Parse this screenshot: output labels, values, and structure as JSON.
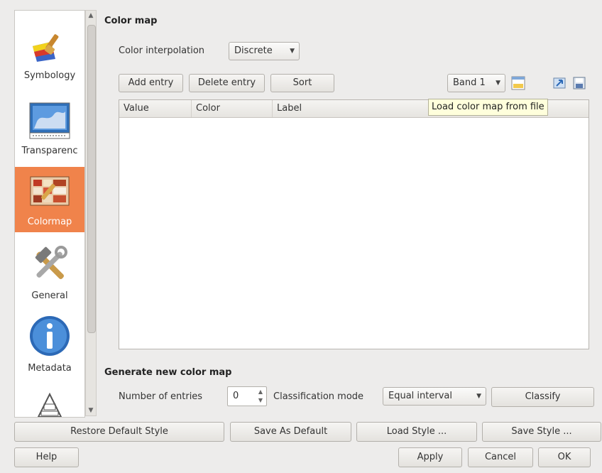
{
  "sidebar": {
    "items": [
      {
        "label": "Symbology",
        "icon": "paintbrush-icon"
      },
      {
        "label": "Transparenc",
        "icon": "transparency-icon"
      },
      {
        "label": "Colormap",
        "icon": "colormap-icon",
        "active": true
      },
      {
        "label": "General",
        "icon": "hammer-wrench-icon"
      },
      {
        "label": "Metadata",
        "icon": "info-icon"
      },
      {
        "label": "",
        "icon": "pyramids-icon"
      }
    ]
  },
  "colormap": {
    "title": "Color map",
    "interpolation_label": "Color interpolation",
    "interpolation_value": "Discrete",
    "add_entry": "Add entry",
    "delete_entry": "Delete entry",
    "sort": "Sort",
    "band_value": "Band 1",
    "table": {
      "columns": [
        "Value",
        "Color",
        "Label"
      ],
      "rows": []
    },
    "tooltip": "Load color map from file"
  },
  "generate": {
    "title": "Generate new color map",
    "num_entries_label": "Number of entries",
    "num_entries_value": "0",
    "classification_label": "Classification mode",
    "classification_value": "Equal interval",
    "classify": "Classify"
  },
  "style_bar": {
    "restore_default": "Restore Default Style",
    "save_default": "Save As Default",
    "load_style": "Load Style ...",
    "save_style": "Save Style ..."
  },
  "dialog_buttons": {
    "help": "Help",
    "apply": "Apply",
    "cancel": "Cancel",
    "ok": "OK"
  },
  "colors": {
    "active_item_bg": "#f0834b",
    "tooltip_bg": "#ffffdc",
    "window_bg": "#edeceb"
  }
}
